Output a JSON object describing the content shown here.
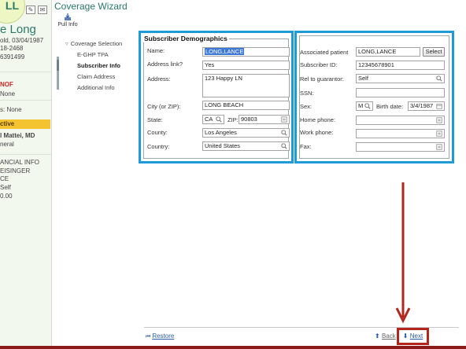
{
  "patient": {
    "initials": "LL",
    "name": "e Long",
    "dob_line": "old, 03/04/1987",
    "phone1": "18-2468",
    "phone2": "6391499",
    "alert": "NOF",
    "allergies": "None",
    "flags": "s: None",
    "status": "ctive",
    "provider": "l Mattei, MD",
    "provider_role": "neral",
    "fin_header": "ANCIAL INFO",
    "payer": "EISINGER",
    "payer2": "CE",
    "relation": "Self",
    "balance": "0.00"
  },
  "header": {
    "title": "Coverage Wizard",
    "pull_info": "Pull Info"
  },
  "nav": {
    "parent": "Coverage Selection",
    "items": [
      {
        "label": "E-GHP TPA"
      },
      {
        "label": "Subscriber Info"
      },
      {
        "label": "Claim Address"
      },
      {
        "label": "Additional Info"
      }
    ]
  },
  "demographics": {
    "title": "Subscriber Demographics",
    "name_label": "Name:",
    "name_value": "LONG,LANCE",
    "address_link_label": "Address link?",
    "address_link_value": "Yes",
    "address_label": "Address:",
    "address_value": "123 Happy LN",
    "city_label": "City (or ZIP):",
    "city_value": "LONG BEACH",
    "state_label": "State:",
    "state_value": "CA",
    "zip_label": "ZIP:",
    "zip_value": "90803",
    "county_label": "County:",
    "county_value": "Los Angeles",
    "country_label": "Country:",
    "country_value": "United States"
  },
  "subscriber": {
    "assoc_label": "Associated patient",
    "assoc_value": "LONG,LANCE",
    "select_label": "Select",
    "id_label": "Subscriber ID:",
    "id_value": "12345678901",
    "rel_label": "Rel to guarantor:",
    "rel_value": "Self",
    "ssn_label": "SSN:",
    "ssn_value": "",
    "sex_label": "Sex:",
    "sex_value": "M",
    "birth_label": "Birth date:",
    "birth_value": "3/4/1987",
    "home_label": "Home phone:",
    "home_value": "",
    "work_label": "Work phone:",
    "work_value": "",
    "fax_label": "Fax:",
    "fax_value": ""
  },
  "footer": {
    "restore": "Restore",
    "back": "Back",
    "next": "Next"
  },
  "colors": {
    "panel_highlight": "#1e9ad6",
    "annotation": "#b3261e",
    "accent": "#2a7a68",
    "active_badge": "#f4c430"
  }
}
